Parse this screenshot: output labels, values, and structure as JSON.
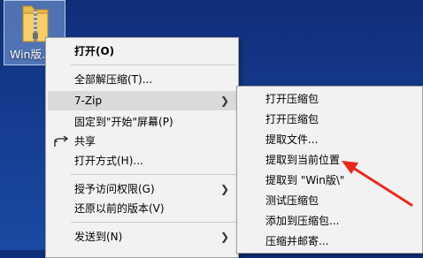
{
  "desktop": {
    "file_name": "Win版..."
  },
  "context_menu": {
    "items": [
      {
        "label": "打开(O)"
      },
      {
        "label": "全部解压缩(T)..."
      },
      {
        "label": "7-Zip"
      },
      {
        "label": "固定到\"开始\"屏幕(P)"
      },
      {
        "label": "共享"
      },
      {
        "label": "打开方式(H)..."
      },
      {
        "label": "授予访问权限(G)"
      },
      {
        "label": "还原以前的版本(V)"
      },
      {
        "label": "发送到(N)"
      }
    ]
  },
  "submenu_7zip": {
    "items": [
      {
        "label": "打开压缩包"
      },
      {
        "label": "打开压缩包"
      },
      {
        "label": "提取文件..."
      },
      {
        "label": "提取到当前位置"
      },
      {
        "label": "提取到 \"Win版\\\""
      },
      {
        "label": "测试压缩包"
      },
      {
        "label": "添加到压缩包..."
      },
      {
        "label": "压缩并邮寄..."
      }
    ]
  },
  "colors": {
    "desktop_bg": "#153b8e",
    "menu_bg": "#f2f2f2",
    "menu_highlight": "#dadada",
    "annotation_arrow": "#e8291d"
  },
  "icons": {
    "file": "zip-folder-icon",
    "share": "share-icon",
    "submenu": "chevron-right-icon"
  }
}
